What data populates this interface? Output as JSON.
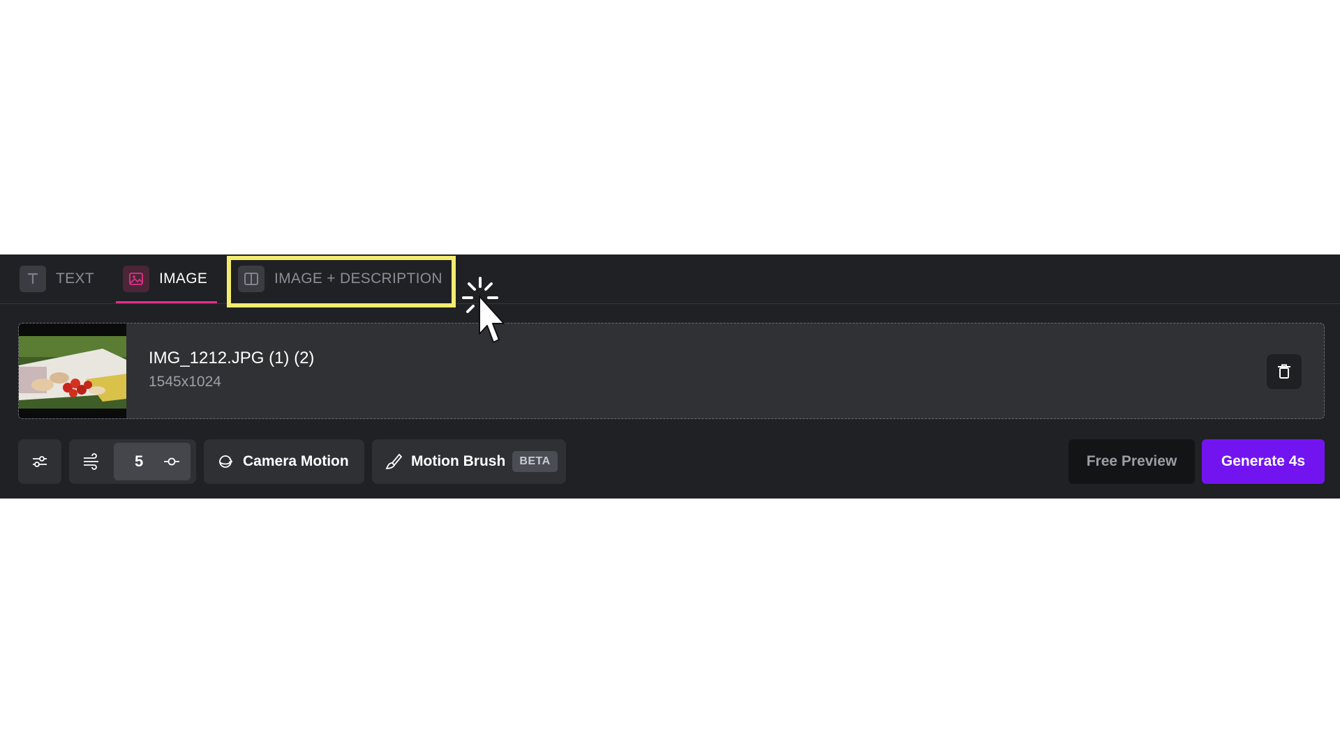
{
  "tabs": [
    {
      "label": "TEXT",
      "icon": "text-t-icon",
      "active": false
    },
    {
      "label": "IMAGE",
      "icon": "image-icon",
      "active": true
    },
    {
      "label": "IMAGE + DESCRIPTION",
      "icon": "split-panel-icon",
      "active": false,
      "highlighted": true
    }
  ],
  "upload": {
    "file_name": "IMG_1212.JPG (1) (2)",
    "dimensions": "1545x1024",
    "thumbnail": "picnic-food-photo"
  },
  "toolbar": {
    "motion_value": "5",
    "camera_motion_label": "Camera Motion",
    "motion_brush_label": "Motion Brush",
    "beta_label": "BETA",
    "free_preview_label": "Free Preview",
    "generate_label": "Generate 4s"
  },
  "colors": {
    "panel_bg": "#202124",
    "accent_pink": "#e0318a",
    "generate_purple": "#7214f0",
    "highlight_yellow": "#f3ec70"
  }
}
